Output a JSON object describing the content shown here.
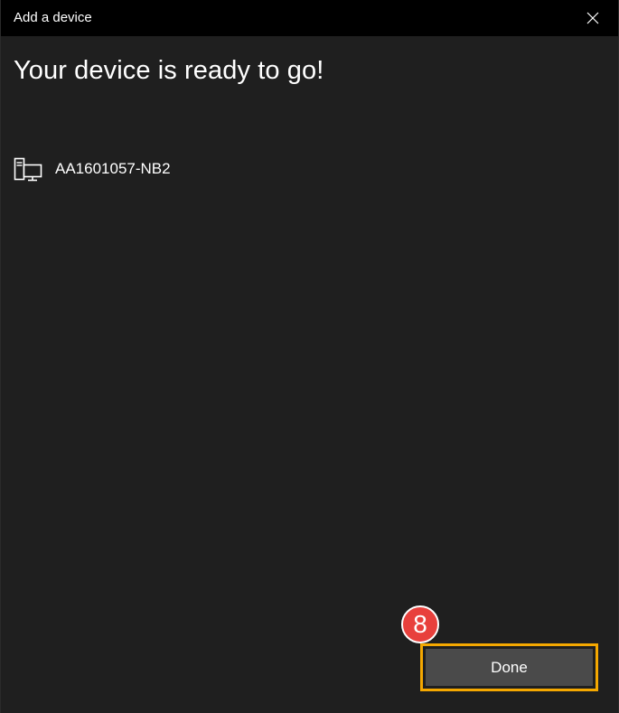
{
  "window": {
    "title": "Add a device",
    "close_icon": "close-icon"
  },
  "content": {
    "heading": "Your device is ready to go!",
    "device": {
      "icon": "computer-device-icon",
      "name": "AA1601057-NB2"
    }
  },
  "footer": {
    "done_label": "Done",
    "step_badge": "8",
    "highlight_color": "#f5a800",
    "badge_color": "#e8403c"
  }
}
